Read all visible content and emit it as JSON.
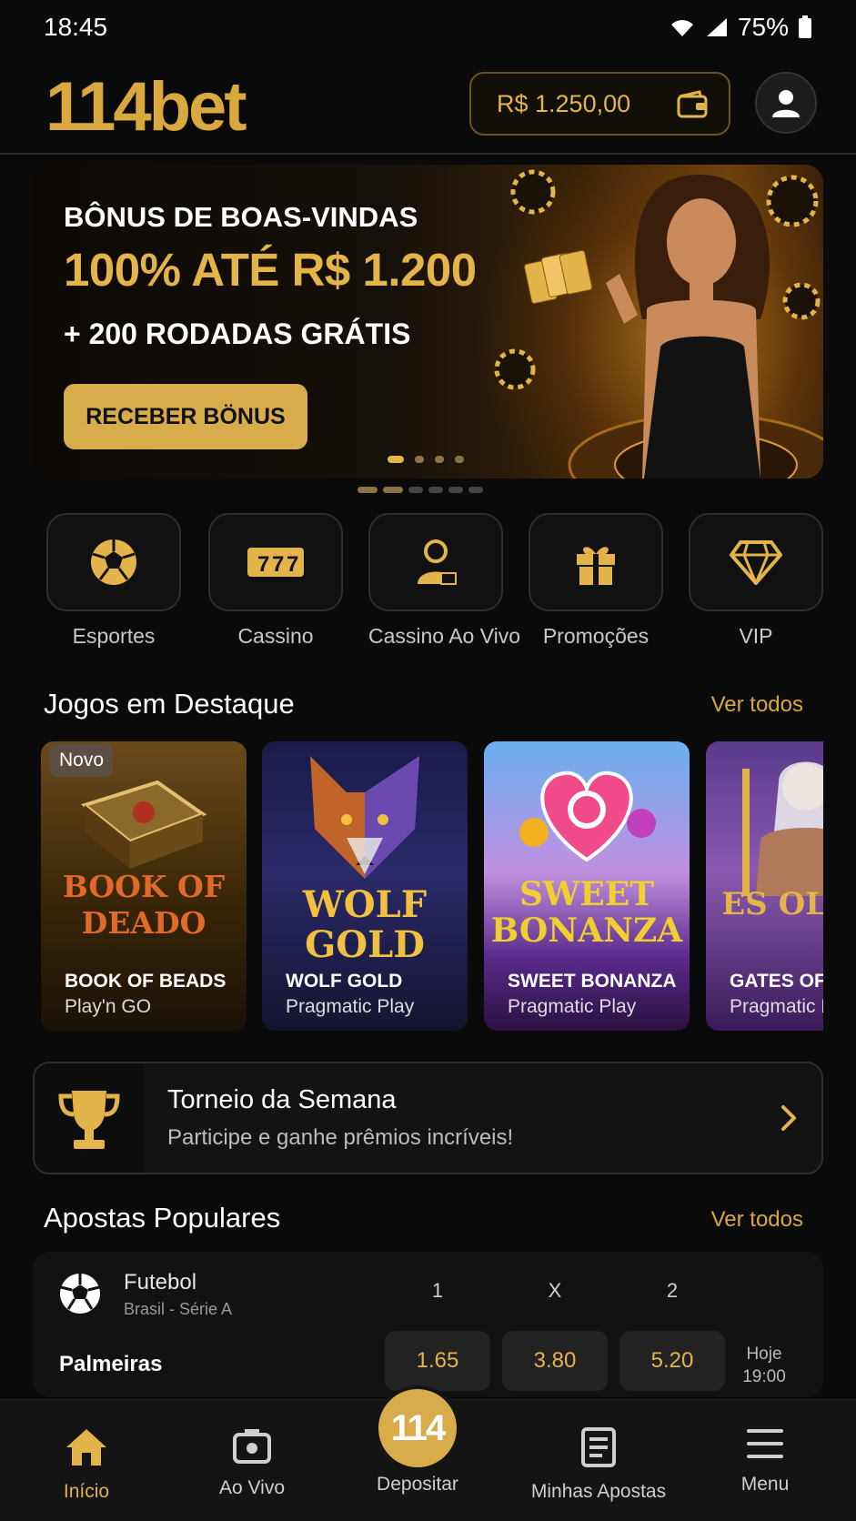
{
  "status_bar": {
    "time": "18:45",
    "battery": "75%"
  },
  "header": {
    "logo": "114bet",
    "balance": "R$ 1.250,00"
  },
  "banner": {
    "subtitle": "BÔNUS DE BOAS-VINDAS",
    "headline": "100% ATÉ R$ 1.200",
    "extra": "+ 200 RODADAS GRÁTIS",
    "cta": "RECEBER BÖNUS"
  },
  "categories": [
    {
      "label": "Esportes",
      "icon": "soccer-ball-icon"
    },
    {
      "label": "Cassino",
      "icon": "slot-777-icon"
    },
    {
      "label": "Cassino Ao Vivo",
      "icon": "live-dealer-icon"
    },
    {
      "label": "Promoções",
      "icon": "gift-icon"
    },
    {
      "label": "VIP",
      "icon": "diamond-icon"
    }
  ],
  "featured": {
    "title": "Jogos em Destaque",
    "see_all": "Ver todos",
    "games": [
      {
        "title": "BOOK OF BEADS",
        "provider": "Play'n GO",
        "badge": "Novo",
        "art": "BOOK OF DEADO"
      },
      {
        "title": "WOLF GOLD",
        "provider": "Pragmatic Play",
        "art": "WOLF GOLD"
      },
      {
        "title": "SWEET BONANZA",
        "provider": "Pragmatic Play",
        "art": "SWEET BONANZA"
      },
      {
        "title": "GATES OF O",
        "provider": "Pragmatic Pl",
        "art": "ES OLYMI"
      }
    ]
  },
  "tournament": {
    "title": "Torneio da Semana",
    "subtitle": "Participe e ganhe prêmios incríveis!"
  },
  "popular": {
    "title": "Apostas Populares",
    "see_all": "Ver todos",
    "sport": "Futebol",
    "league": "Brasil - Série A",
    "columns": [
      "1",
      "X",
      "2"
    ],
    "match": {
      "team": "Palmeiras",
      "odds": [
        "1.65",
        "3.80",
        "5.20"
      ],
      "day": "Hoje",
      "time": "19:00"
    }
  },
  "nav": {
    "items": [
      {
        "label": "Início",
        "icon": "home-icon"
      },
      {
        "label": "Ao Vivo",
        "icon": "live-camera-icon"
      },
      {
        "label": "Depositar",
        "icon": "deposit-114-icon"
      },
      {
        "label": "Minhas Apostas",
        "icon": "receipt-icon"
      },
      {
        "label": "Menu",
        "icon": "hamburger-menu-icon"
      }
    ],
    "deposit_badge": "114"
  },
  "colors": {
    "accent": "#d9ac4b",
    "background": "#0a0a0a",
    "card": "#131313"
  }
}
